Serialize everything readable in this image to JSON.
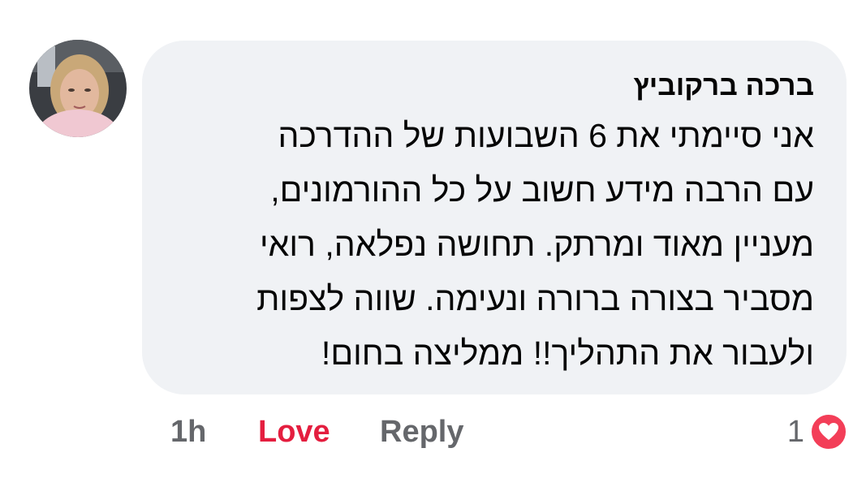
{
  "comment": {
    "author": "ברכה ברקוביץ",
    "lines": [
      "אני סיימתי את 6 השבועות של ההדרכה",
      "עם הרבה מידע חשוב על כל ההורמונים,",
      "מעניין מאוד ומרתק. תחושה נפלאה, רואי",
      "מסביר בצורה ברורה ונעימה. שווה לצפות",
      "ולעבור את התהליך!! ממליצה בחום!"
    ]
  },
  "actions": {
    "time": "1h",
    "love": "Love",
    "reply": "Reply"
  },
  "reactions": {
    "count": "1",
    "icon": "heart-icon"
  },
  "colors": {
    "bubble": "#f0f2f5",
    "love": "#e41e3f",
    "muted": "#65676b",
    "heart": "#f33e58"
  }
}
